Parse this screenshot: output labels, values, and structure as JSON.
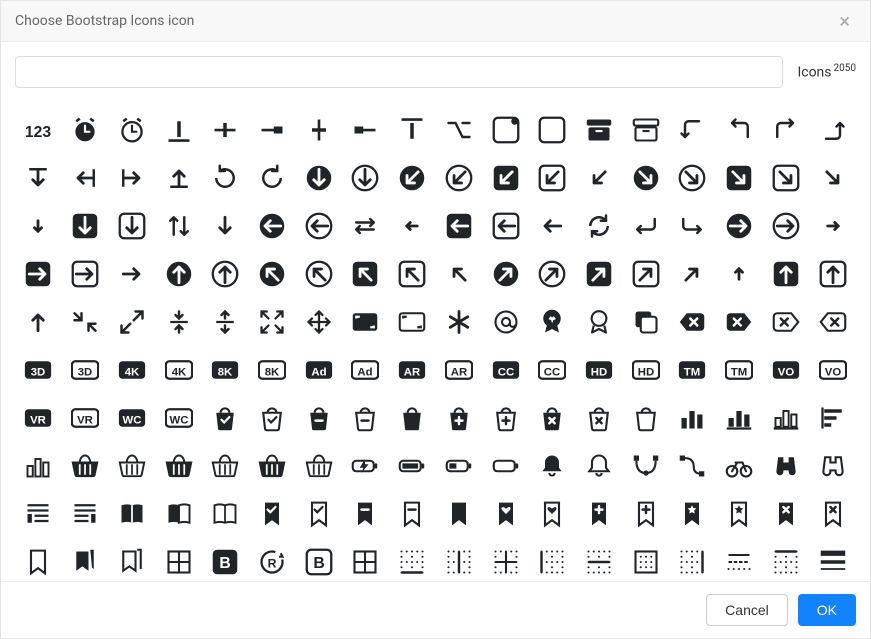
{
  "header": {
    "title": "Choose Bootstrap Icons icon",
    "close_glyph": "×"
  },
  "search": {
    "placeholder": "",
    "value": ""
  },
  "count": {
    "label": "Icons",
    "value": "2050"
  },
  "footer": {
    "cancel": "Cancel",
    "ok": "OK"
  },
  "icons": [
    "123",
    "alarm-fill",
    "alarm",
    "align-bottom",
    "align-center",
    "align-end",
    "align-middle",
    "align-start",
    "align-top",
    "alt",
    "app-indicator",
    "app",
    "archive-fill",
    "archive",
    "arrow-90deg-down",
    "arrow-90deg-left",
    "arrow-90deg-right",
    "arrow-90deg-up",
    "arrow-bar-down",
    "arrow-bar-left",
    "arrow-bar-right",
    "arrow-bar-up",
    "arrow-clockwise",
    "arrow-counterclockwise",
    "arrow-down-circle-fill",
    "arrow-down-circle",
    "arrow-down-left-circle-fill",
    "arrow-down-left-circle",
    "arrow-down-left-square-fill",
    "arrow-down-left-square",
    "arrow-down-left",
    "arrow-down-right-circle-fill",
    "arrow-down-right-circle",
    "arrow-down-right-square-fill",
    "arrow-down-right-square",
    "arrow-down-right",
    "arrow-down-short",
    "arrow-down-square-fill",
    "arrow-down-square",
    "arrow-down-up",
    "arrow-down",
    "arrow-left-circle-fill",
    "arrow-left-circle",
    "arrow-left-right",
    "arrow-left-short",
    "arrow-left-square-fill",
    "arrow-left-square",
    "arrow-left",
    "arrow-repeat",
    "arrow-return-left",
    "arrow-return-right",
    "arrow-right-circle-fill",
    "arrow-right-circle",
    "arrow-right-short",
    "arrow-right-square-fill",
    "arrow-right-square",
    "arrow-right",
    "arrow-up-circle-fill",
    "arrow-up-circle",
    "arrow-up-left-circle-fill",
    "arrow-up-left-circle",
    "arrow-up-left-square-fill",
    "arrow-up-left-square",
    "arrow-up-left",
    "arrow-up-right-circle-fill",
    "arrow-up-right-circle",
    "arrow-up-right-square-fill",
    "arrow-up-right-square",
    "arrow-up-right",
    "arrow-up-short",
    "arrow-up-square-fill",
    "arrow-up-square",
    "arrow-up",
    "arrows-angle-contract",
    "arrows-angle-expand",
    "arrows-collapse",
    "arrows-expand",
    "arrows-fullscreen",
    "arrows-move",
    "aspect-ratio-fill",
    "aspect-ratio",
    "asterisk",
    "at",
    "award-fill",
    "award",
    "back",
    "backspace-fill",
    "backspace-reverse-fill",
    "backspace-reverse",
    "backspace",
    "badge-3d-fill",
    "badge-3d",
    "badge-4k-fill",
    "badge-4k",
    "badge-8k-fill",
    "badge-8k",
    "badge-ad-fill",
    "badge-ad",
    "badge-ar-fill",
    "badge-ar",
    "badge-cc-fill",
    "badge-cc",
    "badge-hd-fill",
    "badge-hd",
    "badge-tm-fill",
    "badge-tm",
    "badge-vo-fill",
    "badge-vo",
    "badge-vr-fill",
    "badge-vr",
    "badge-wc-fill",
    "badge-wc",
    "bag-check-fill",
    "bag-check",
    "bag-dash-fill",
    "bag-dash",
    "bag-fill",
    "bag-plus-fill",
    "bag-plus",
    "bag-x-fill",
    "bag-x",
    "bag",
    "bar-chart-fill",
    "bar-chart-line-fill",
    "bar-chart-line",
    "bar-chart-steps",
    "bar-chart",
    "basket-fill",
    "basket",
    "basket2-fill",
    "basket2",
    "basket3-fill",
    "basket3",
    "battery-charging",
    "battery-full",
    "battery-half",
    "battery",
    "bell-fill",
    "bell",
    "bezier",
    "bezier2",
    "bicycle",
    "binoculars-fill",
    "binoculars",
    "blockquote-left",
    "blockquote-right",
    "book-fill",
    "book-half",
    "book",
    "bookmark-check-fill",
    "bookmark-check",
    "bookmark-dash-fill",
    "bookmark-dash",
    "bookmark-fill",
    "bookmark-heart-fill",
    "bookmark-heart",
    "bookmark-plus-fill",
    "bookmark-plus",
    "bookmark-star-fill",
    "bookmark-star",
    "bookmark-x-fill",
    "bookmark-x",
    "bookmark",
    "bookmarks-fill",
    "bookmarks",
    "border-all",
    "bootstrap-fill",
    "bootstrap-reboot",
    "bootstrap",
    "border-all",
    "border-bottom",
    "border-center",
    "border-inner",
    "border-left",
    "border-middle",
    "border-outer",
    "border-right",
    "border-style",
    "border-top",
    "border-width"
  ]
}
